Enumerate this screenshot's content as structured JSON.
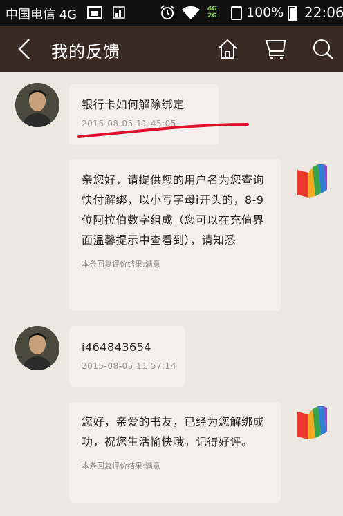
{
  "status_bar": {
    "carrier": "中国电信 4G",
    "battery": "100%",
    "time": "22:06",
    "network_tags": [
      "4G",
      "2G"
    ]
  },
  "title_bar": {
    "title": "我的反馈"
  },
  "messages": [
    {
      "from": "user",
      "text": "银行卡如何解除绑定",
      "time": "2015-08-05 11:45:05"
    },
    {
      "from": "service",
      "text": "亲您好，请提供您的用户名为您查询快付解绑，以小写字母i开头的，8-9位阿拉伯数字组成（您可以在充值界面温馨提示中查看到），请知悉",
      "rating": "本条回复评价结果:满意"
    },
    {
      "from": "user",
      "text": "i464843654",
      "time": "2015-08-05 11:57:14"
    },
    {
      "from": "service",
      "text": "您好，亲爱的书友，已经为您解绑成功，祝您生活愉快哦。记得好评。",
      "rating": "本条回复评价结果:满意"
    }
  ],
  "colors": {
    "background": "#ede7e2",
    "title_bar": "#3a2a24",
    "bubble": "#f4efec",
    "annotation": "#e0102a"
  }
}
